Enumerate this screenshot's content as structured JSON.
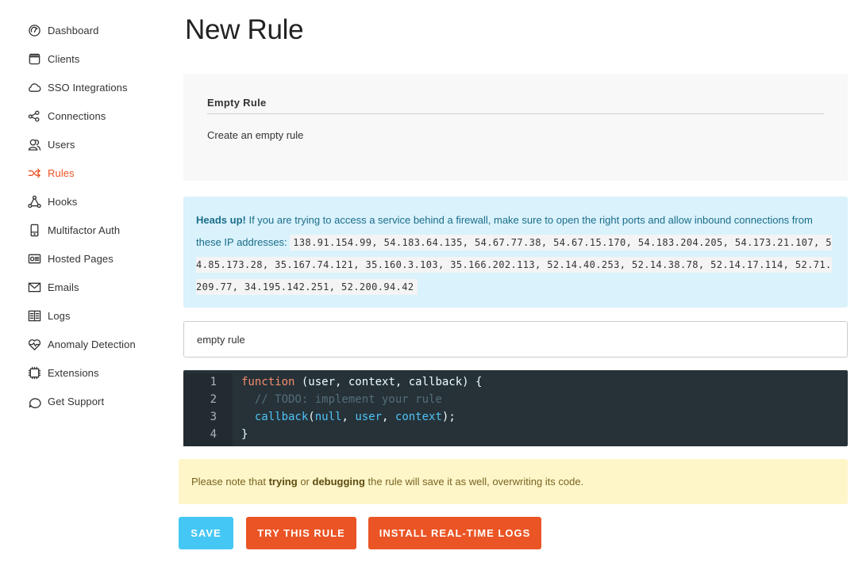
{
  "sidebar": {
    "items": [
      {
        "label": "Dashboard",
        "icon": "dashboard-gauge-icon",
        "active": false
      },
      {
        "label": "Clients",
        "icon": "clients-window-icon",
        "active": false
      },
      {
        "label": "SSO Integrations",
        "icon": "cloud-icon",
        "active": false
      },
      {
        "label": "Connections",
        "icon": "connections-share-icon",
        "active": false
      },
      {
        "label": "Users",
        "icon": "users-icon",
        "active": false
      },
      {
        "label": "Rules",
        "icon": "shuffle-icon",
        "active": true
      },
      {
        "label": "Hooks",
        "icon": "hooks-nodes-icon",
        "active": false
      },
      {
        "label": "Multifactor Auth",
        "icon": "mobile-device-icon",
        "active": false
      },
      {
        "label": "Hosted Pages",
        "icon": "hosted-pages-icon",
        "active": false
      },
      {
        "label": "Emails",
        "icon": "envelope-icon",
        "active": false
      },
      {
        "label": "Logs",
        "icon": "book-icon",
        "active": false
      },
      {
        "label": "Anomaly Detection",
        "icon": "heart-pulse-icon",
        "active": false
      },
      {
        "label": "Extensions",
        "icon": "chip-icon",
        "active": false
      },
      {
        "label": "Get Support",
        "icon": "chat-bubble-icon",
        "active": false
      }
    ],
    "active_color": "#eb5424"
  },
  "page": {
    "title": "New Rule"
  },
  "template": {
    "title": "Empty Rule",
    "description": "Create an empty rule"
  },
  "info_alert": {
    "lead": "Heads up!",
    "text": " If you are trying to access a service behind a firewall, make sure to open the right ports and allow inbound connections from these IP addresses: ",
    "ip_addresses": "138.91.154.99, 54.183.64.135, 54.67.77.38, 54.67.15.170, 54.183.204.205, 54.173.21.107, 54.85.173.28, 35.167.74.121, 35.160.3.103, 35.166.202.113, 52.14.40.253, 52.14.38.78, 52.14.17.114, 52.71.209.77, 34.195.142.251, 52.200.94.42"
  },
  "rule_name_input": {
    "value": "empty rule"
  },
  "code_editor": {
    "line_numbers": [
      "1",
      "2",
      "3",
      "4"
    ],
    "lines": {
      "l1_keyword": "function",
      "l1_rest": " (user, context, callback) {",
      "l2_comment": "  // TODO: implement your rule",
      "l3_indent": "  ",
      "l3_fn": "callback",
      "l3_open": "(",
      "l3_arg1": "null",
      "l3_sep1": ", ",
      "l3_arg2": "user",
      "l3_sep2": ", ",
      "l3_arg3": "context",
      "l3_close": ");",
      "l4": "}"
    }
  },
  "warning": {
    "part1": "Please note that ",
    "bold1": "trying",
    "part2": " or ",
    "bold2": "debugging",
    "part3": " the rule will save it as well, overwriting its code."
  },
  "buttons": {
    "save": "SAVE",
    "try": "TRY THIS RULE",
    "logs": "INSTALL REAL-TIME LOGS"
  },
  "colors": {
    "accent": "#eb5424",
    "save_button": "#44c7f4",
    "info_bg": "#d9f2fc",
    "warning_bg": "#fef6c9",
    "editor_bg": "#263238"
  }
}
